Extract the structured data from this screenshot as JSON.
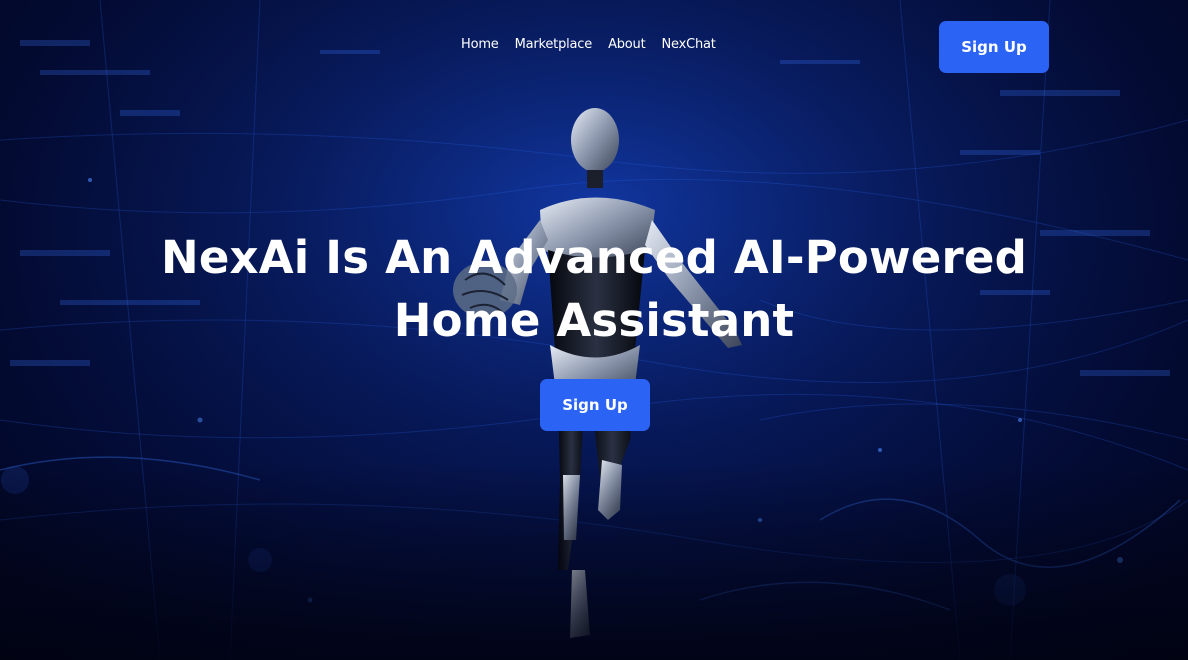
{
  "nav": {
    "items": [
      {
        "label": "Home"
      },
      {
        "label": "Marketplace"
      },
      {
        "label": "About"
      },
      {
        "label": "NexChat"
      }
    ]
  },
  "header": {
    "signup_label": "Sign Up"
  },
  "hero": {
    "title_line1": "NexAi Is An Advanced AI-Powered",
    "title_line2": "Home Assistant",
    "signup_label": "Sign Up"
  },
  "colors": {
    "accent": "#2b63f5",
    "background": "#030b34",
    "text": "#ffffff"
  }
}
